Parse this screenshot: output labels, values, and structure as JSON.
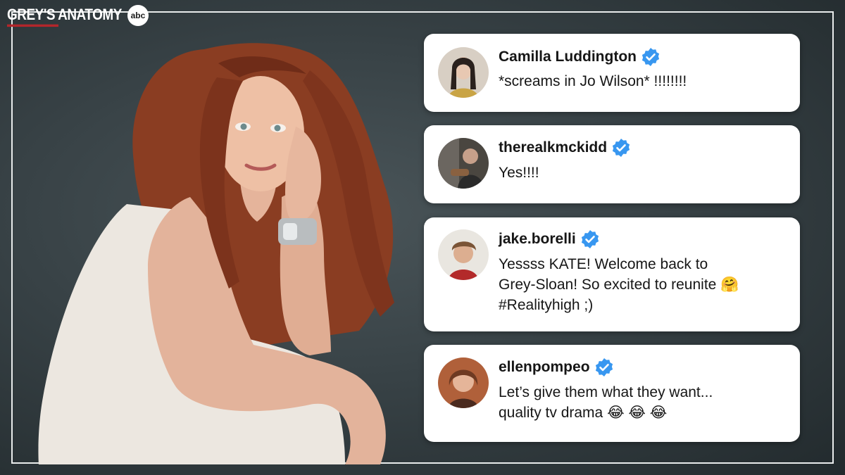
{
  "brand": {
    "show_title": "GREY'S ANATOMY",
    "network": "abc"
  },
  "comments": [
    {
      "username": "Camilla Luddington",
      "text": "*screams in Jo Wilson*  !!!!!!!!"
    },
    {
      "username": "therealkmckidd",
      "text": "Yes!!!!"
    },
    {
      "username": "jake.borelli",
      "text_lines": [
        "Yessss KATE! Welcome back to",
        "Grey-Sloan! So excited to reunite 🤗",
        "#Realityhigh ;)"
      ]
    },
    {
      "username": "ellenpompeo",
      "text_lines": [
        "Let’s give them what they want...",
        "quality tv drama 😂 😂 😂"
      ]
    }
  ],
  "colors": {
    "verified": "#3897f0",
    "card": "#ffffff",
    "background": "#3a4447",
    "brand_accent": "#b3262b"
  }
}
